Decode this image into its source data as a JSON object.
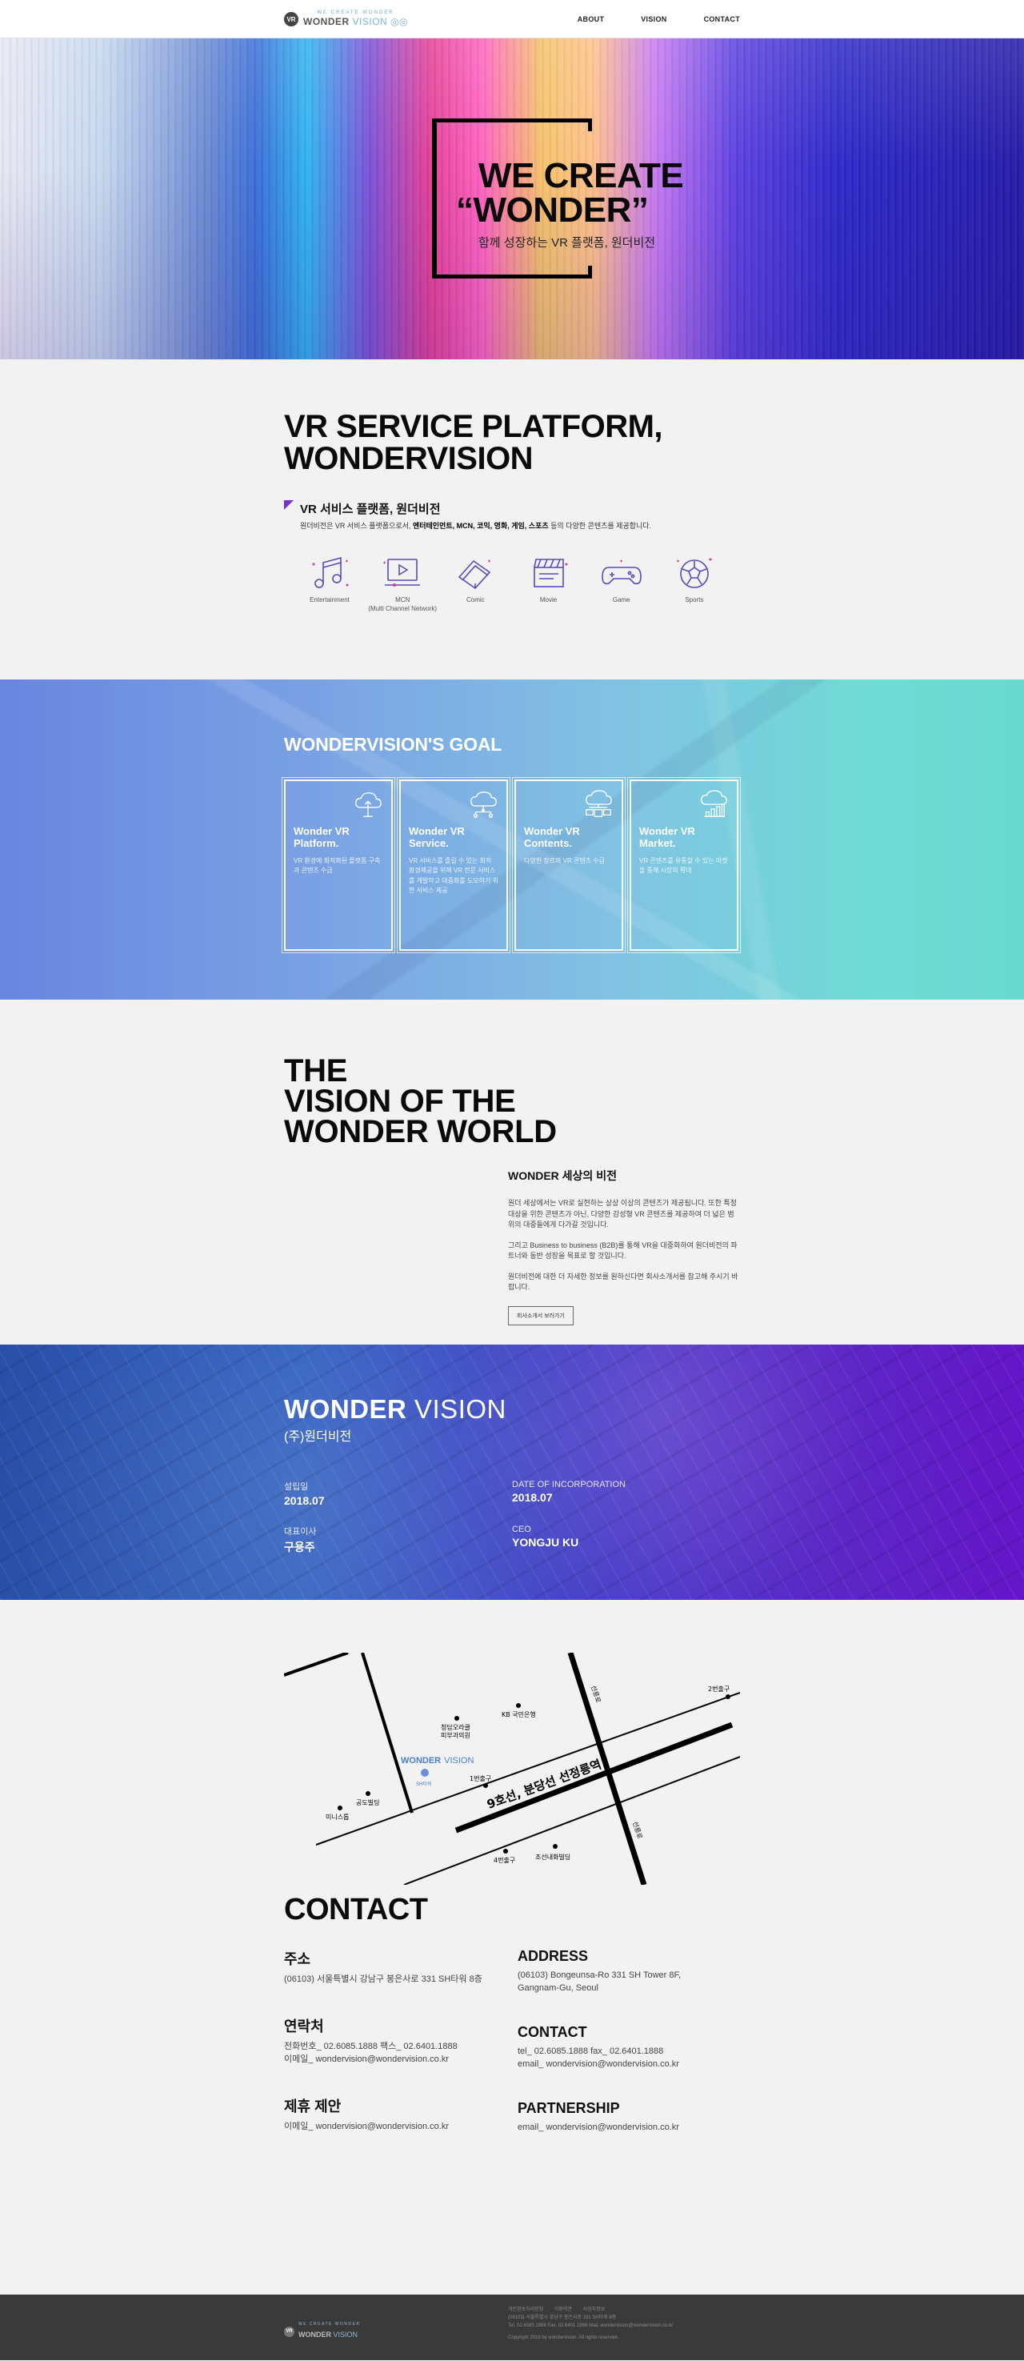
{
  "header": {
    "logo_mark": "VR",
    "logo_tag": "WE CREATE WONDER",
    "logo_bold": "WONDER",
    "logo_light": "VISION",
    "nav": [
      "ABOUT",
      "VISION",
      "CONTACT"
    ]
  },
  "hero": {
    "title_line1": "WE CREATE",
    "title_line2": "“WONDER”",
    "subtitle": "함께 성장하는 VR 플랫폼, 원더비전"
  },
  "platform": {
    "title_line1": "VR SERVICE PLATFORM,",
    "title_line2": "WONDERVISION",
    "ko_title": "VR 서비스 플랫폼, 원더비전",
    "desc_prefix": "원더비전은 VR 서비스 플랫폼으로서, ",
    "desc_bold": "엔터테인먼트, MCN, 코믹, 영화, 게임, 스포츠",
    "desc_suffix": " 등의 다양한 콘텐츠를 제공합니다.",
    "categories": [
      {
        "icon": "music-icon",
        "label": "Entertainment",
        "sub": ""
      },
      {
        "icon": "video-play-icon",
        "label": "MCN",
        "sub": "(Multi Channel Network)"
      },
      {
        "icon": "comic-book-icon",
        "label": "Comic",
        "sub": ""
      },
      {
        "icon": "clapperboard-icon",
        "label": "Movie",
        "sub": ""
      },
      {
        "icon": "gamepad-icon",
        "label": "Game",
        "sub": ""
      },
      {
        "icon": "soccer-ball-icon",
        "label": "Sports",
        "sub": ""
      }
    ],
    "accent_color": "#7b2fd6"
  },
  "goal": {
    "title": "WONDERVISION'S GOAL",
    "cards": [
      {
        "icon": "cloud-upload-icon",
        "title1": "Wonder VR",
        "title2": "Platform.",
        "desc": "VR 환경에 최적화된 플랫폼 구축과 콘텐츠 수급"
      },
      {
        "icon": "cloud-network-icon",
        "title1": "Wonder VR",
        "title2": "Service.",
        "desc": "VR 서비스를 즐길 수 있는 최적 환경제공을 위해 VR 전문 서비스를 개발하고 대중화를 도모하기 위한 서비스 제공"
      },
      {
        "icon": "cloud-devices-icon",
        "title1": "Wonder VR",
        "title2": "Contents.",
        "desc": "다양한 장르의 VR 콘텐츠 수급"
      },
      {
        "icon": "cloud-chart-icon",
        "title1": "Wonder VR",
        "title2": "Market.",
        "desc": "VR 콘텐츠를 유통할 수 있는 마켓을 통해 시장의 확대"
      }
    ]
  },
  "vision": {
    "title_line1": "THE",
    "title_line2": "VISION OF THE",
    "title_line3": "WONDER WORLD",
    "head": "WONDER 세상의 비전",
    "para1": "원더 세상에서는 VR로 실현하는 상상 이상의 콘텐츠가 제공됩니다. 또한 특정 대상을 위한 콘텐츠가 아닌, 다양한 감성형 VR 콘텐츠를 제공하여 더 넓은 범위의 대중들에게 다가갈 것입니다.",
    "para2": "그리고 Business to business (B2B)를 통해 VR을 대중화하여 원더비전의 파트너와 동반 성장을 목표로 할 것입니다.",
    "para3": "원더비전에 대한 더 자세한 정보를 원하신다면 회사소개서를 참고해 주시기 바랍니다.",
    "button": "회사소개서 보러가기"
  },
  "company": {
    "brand_bold": "WONDER",
    "brand_light": "VISION",
    "name_ko": "(주)원더비전",
    "items": [
      {
        "label": "설립일",
        "value": "2018.07"
      },
      {
        "label": "DATE OF INCORPORATION",
        "value": "2018.07"
      },
      {
        "label": "대표이사",
        "value": "구용주"
      },
      {
        "label": "CEO",
        "value": "YONGJU KU"
      }
    ]
  },
  "map": {
    "labels": {
      "exit2": "2번출구",
      "exit1": "1번출구",
      "exit4": "4번출구",
      "station": "9호선, 분당선 선정릉역",
      "road_v1": "선릉로",
      "road_v2": "선릉로",
      "kb": "KB 국민은행",
      "clinic_1": "청담오라클",
      "clinic_2": "피부과의원",
      "gongdo": "공도빌딩",
      "ministop": "미니스톱",
      "joseon": "조선내화빌딩",
      "brand_bold": "WONDER",
      "brand_light": "VISION",
      "tower": "SH타워"
    }
  },
  "contact": {
    "title": "CONTACT",
    "ko": [
      {
        "head": "주소",
        "lines": [
          "(06103) 서울특별시 강남구 봉은사로 331 SH타워 8층"
        ]
      },
      {
        "head": "연락처",
        "lines": [
          "전화번호_ 02.6085.1888     팩스_ 02.6401.1888",
          "이메일_ wondervision@wondervision.co.kr"
        ]
      },
      {
        "head": "제휴 제안",
        "lines": [
          "이메일_ wondervision@wondervision.co.kr"
        ]
      }
    ],
    "en": [
      {
        "head": "ADDRESS",
        "lines": [
          "(06103) Bongeunsa-Ro 331 SH Tower 8F,",
          "Gangnam-Gu, Seoul"
        ]
      },
      {
        "head": "CONTACT",
        "lines": [
          "tel_ 02.6085.1888     fax_ 02.6401.1888",
          "email_ wondervision@wondervision.co.kr"
        ]
      },
      {
        "head": "PARTNERSHIP",
        "lines": [
          "email_ wondervision@wondervision.co.kr"
        ]
      }
    ]
  },
  "footer": {
    "logo_mark": "VR",
    "logo_tag": "WE CREATE WONDER",
    "logo_bold": "WONDER",
    "logo_light": "VISION",
    "links": [
      "개인정보처리방침",
      "이용약관",
      "사업자정보"
    ],
    "addr": "(06103) 서울특별시 강남구 봉은사로 331 SH타워 8층",
    "tel": "Tel. 02.6085.1888     Fax. 02.6401.1888     Mail. wondervision@wondervision.co.kr",
    "copyright": "Copyright 2018 by wondervision. All rights reserved."
  }
}
